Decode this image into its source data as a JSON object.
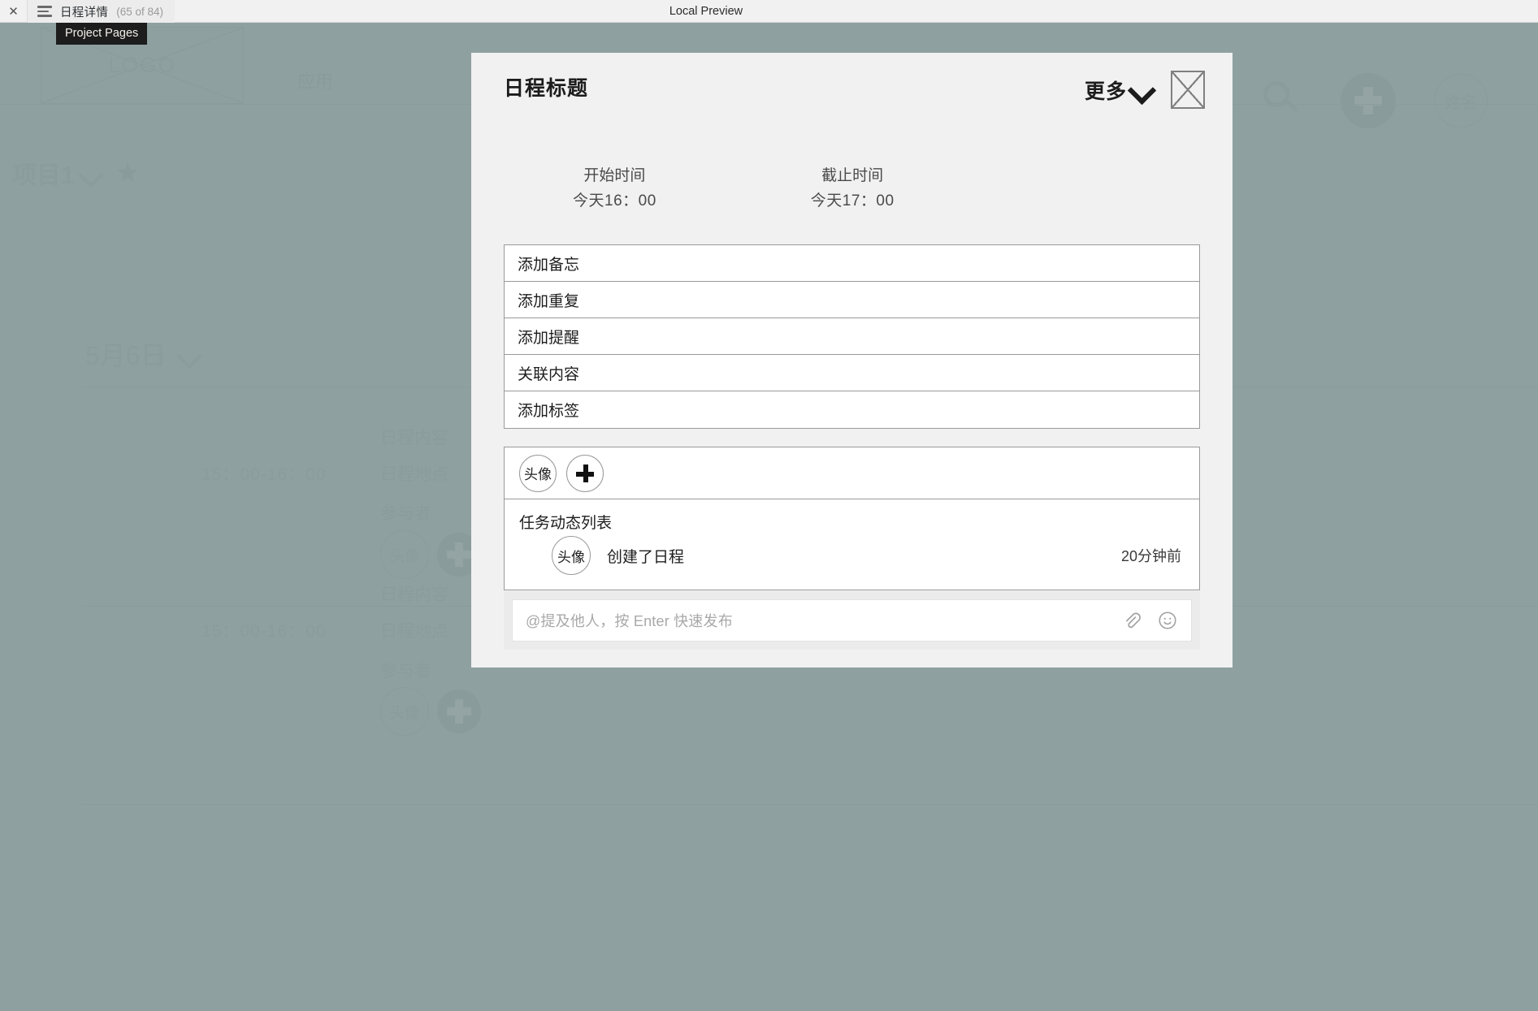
{
  "topbar": {
    "close_icon": "close-icon",
    "menu_icon": "hamburger-menu-icon",
    "tab_title": "日程详情",
    "tab_count": "(65 of 84)",
    "center_label": "Local Preview"
  },
  "tooltip": {
    "text": "Project Pages"
  },
  "background": {
    "logo_label": "LOGO",
    "apply_label": "应用",
    "project_label": "项目1",
    "star_glyph": "★",
    "search_icon": "search-icon",
    "add_icon": "plus-circle-icon",
    "user_label": "姓名",
    "date_label": "5月6日",
    "events": [
      {
        "title": "日程内容",
        "time": "15：00-16：00",
        "place": "日程地点",
        "participants_label": "参与者",
        "avatar_label": "头像"
      },
      {
        "title": "日程内容",
        "time": "15：00-16：00",
        "place": "日程地点",
        "participants_label": "参与者",
        "avatar_label": "头像"
      }
    ]
  },
  "modal": {
    "title": "日程标题",
    "more_label": "更多",
    "more_chevron_icon": "chevron-down-icon",
    "close_icon": "close-placeholder-icon",
    "time": {
      "start_label": "开始时间",
      "start_value": "今天16：00",
      "end_label": "截止时间",
      "end_value": "今天17：00"
    },
    "options": [
      {
        "label": "添加备忘"
      },
      {
        "label": "添加重复"
      },
      {
        "label": "添加提醒"
      },
      {
        "label": "关联内容"
      },
      {
        "label": "添加标签"
      }
    ],
    "participants": {
      "avatar_label": "头像",
      "add_icon": "plus-icon"
    },
    "activity": {
      "title": "任务动态列表",
      "items": [
        {
          "avatar_label": "头像",
          "text": "创建了日程",
          "time": "20分钟前"
        }
      ]
    },
    "comment": {
      "placeholder": "@提及他人，按 Enter 快速发布",
      "attach_icon": "attachment-icon",
      "emoji_icon": "emoji-icon"
    }
  },
  "colors": {
    "overlay": "#8fa0a0",
    "modal_bg": "#f1f1f1",
    "card_border": "#9a9a9a",
    "text": "#1d1d1d"
  }
}
